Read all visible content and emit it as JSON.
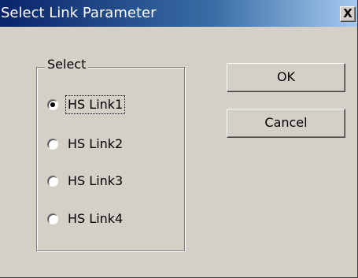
{
  "window": {
    "title": "Select Link Parameter",
    "close_glyph": "X",
    "close_icon": "close-icon"
  },
  "group": {
    "label": "Select",
    "options": [
      {
        "label": "HS Link1",
        "selected": true
      },
      {
        "label": "HS Link2",
        "selected": false
      },
      {
        "label": "HS Link3",
        "selected": false
      },
      {
        "label": "HS Link4",
        "selected": false
      }
    ]
  },
  "buttons": {
    "ok_label": "OK",
    "cancel_label": "Cancel"
  },
  "colors": {
    "titlebar_start": "#0a246a",
    "titlebar_end": "#a6caf0",
    "dialog_face": "#d4d0c8"
  }
}
